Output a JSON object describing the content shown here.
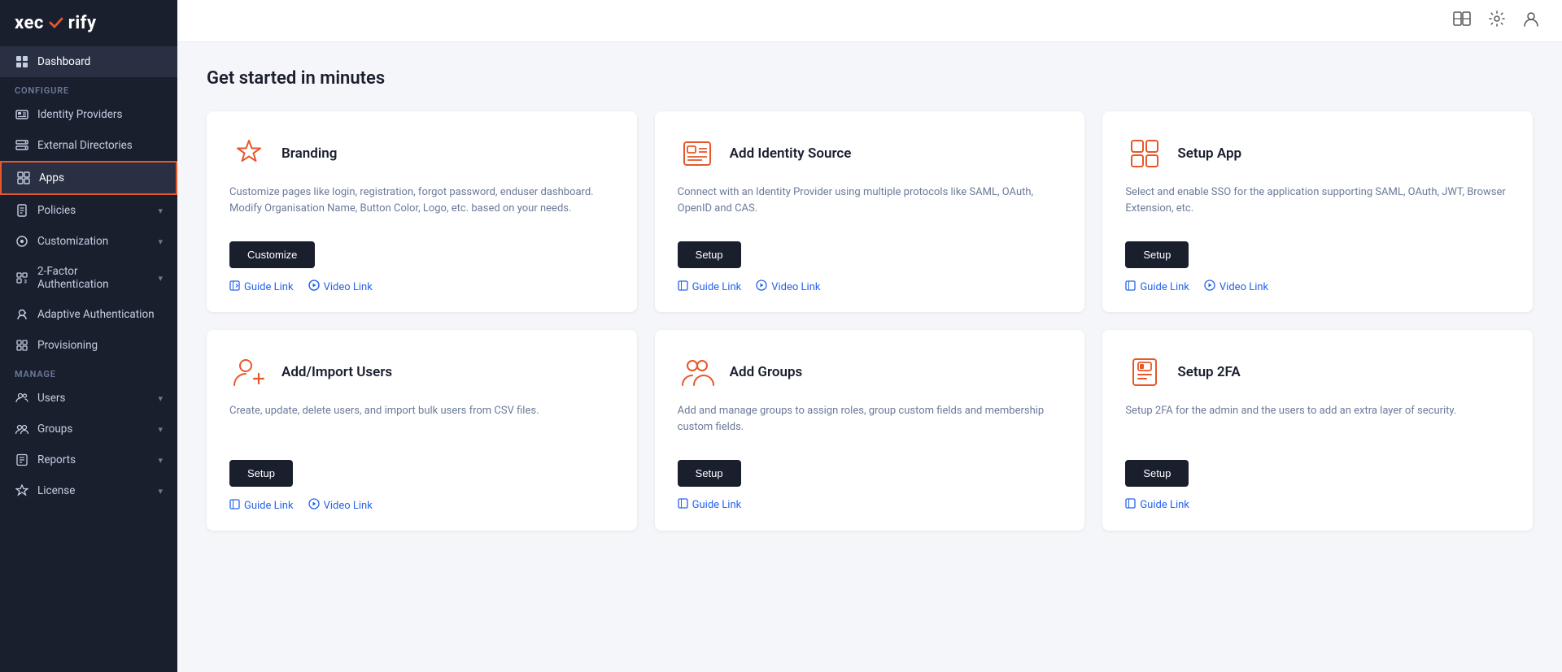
{
  "logo": {
    "text_before": "xec",
    "check": "✓",
    "text_after": "rify"
  },
  "sidebar": {
    "active_item": "dashboard",
    "highlighted_item": "apps",
    "dashboard_label": "Dashboard",
    "configure_label": "Configure",
    "items_configure": [
      {
        "id": "identity-providers",
        "label": "Identity Providers",
        "icon": "id"
      },
      {
        "id": "external-directories",
        "label": "External Directories",
        "icon": "ext"
      },
      {
        "id": "apps",
        "label": "Apps",
        "icon": "apps"
      },
      {
        "id": "policies",
        "label": "Policies",
        "icon": "policies",
        "has_chevron": true
      },
      {
        "id": "customization",
        "label": "Customization",
        "icon": "custom",
        "has_chevron": true
      },
      {
        "id": "2fa",
        "label": "2-Factor Authentication",
        "icon": "2fa",
        "has_chevron": true
      },
      {
        "id": "adaptive-auth",
        "label": "Adaptive Authentication",
        "icon": "adaptive"
      },
      {
        "id": "provisioning",
        "label": "Provisioning",
        "icon": "provisioning"
      }
    ],
    "manage_label": "Manage",
    "items_manage": [
      {
        "id": "users",
        "label": "Users",
        "icon": "users",
        "has_chevron": true
      },
      {
        "id": "groups",
        "label": "Groups",
        "icon": "groups",
        "has_chevron": true
      },
      {
        "id": "reports",
        "label": "Reports",
        "icon": "reports",
        "has_chevron": true
      },
      {
        "id": "license",
        "label": "License",
        "icon": "license",
        "has_chevron": true
      }
    ]
  },
  "topbar": {
    "book_icon": "📖",
    "settings_icon": "⚙",
    "user_icon": "👤"
  },
  "main": {
    "page_title": "Get started in minutes",
    "cards": [
      {
        "id": "branding",
        "title": "Branding",
        "desc": "Customize pages like login, registration, forgot password, enduser dashboard. Modify Organisation Name, Button Color, Logo, etc. based on your needs.",
        "btn_label": "Customize",
        "guide_label": "Guide Link",
        "video_label": "Video Link",
        "has_video": true,
        "icon_type": "star"
      },
      {
        "id": "add-identity-source",
        "title": "Add Identity Source",
        "desc": "Connect with an Identity Provider using multiple protocols like SAML, OAuth, OpenID and CAS.",
        "btn_label": "Setup",
        "guide_label": "Guide Link",
        "video_label": "Video Link",
        "has_video": true,
        "icon_type": "id-source"
      },
      {
        "id": "setup-app",
        "title": "Setup App",
        "desc": "Select and enable SSO for the application supporting SAML, OAuth, JWT, Browser Extension, etc.",
        "btn_label": "Setup",
        "guide_label": "Guide Link",
        "video_label": "Video Link",
        "has_video": true,
        "icon_type": "app-grid"
      },
      {
        "id": "add-import-users",
        "title": "Add/Import Users",
        "desc": "Create, update, delete users, and import bulk users from CSV files.",
        "btn_label": "Setup",
        "guide_label": "Guide Link",
        "video_label": "Video Link",
        "has_video": true,
        "icon_type": "user-add"
      },
      {
        "id": "add-groups",
        "title": "Add Groups",
        "desc": "Add and manage groups to assign roles, group custom fields and membership custom fields.",
        "btn_label": "Setup",
        "guide_label": "Guide Link",
        "video_label": null,
        "has_video": false,
        "icon_type": "groups"
      },
      {
        "id": "setup-2fa",
        "title": "Setup 2FA",
        "desc": "Setup 2FA for the admin and the users to add an extra layer of security.",
        "btn_label": "Setup",
        "guide_label": "Guide Link",
        "video_label": null,
        "has_video": false,
        "icon_type": "2fa-lock"
      }
    ]
  }
}
